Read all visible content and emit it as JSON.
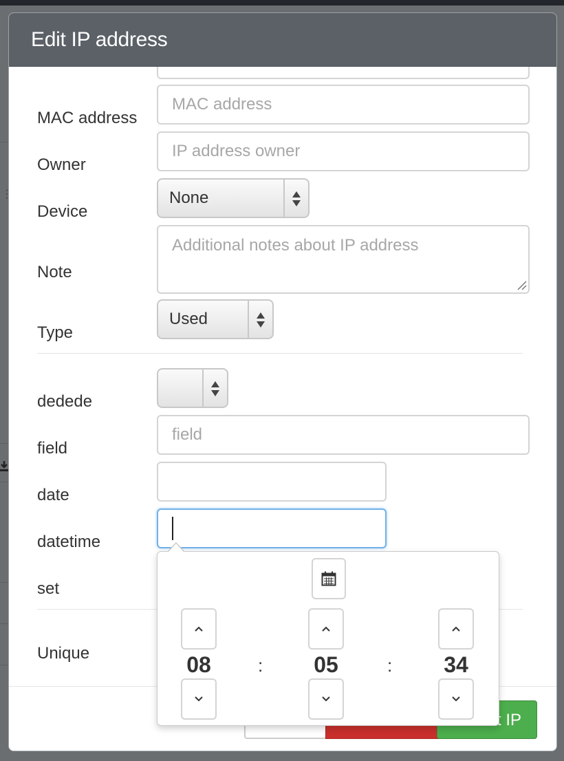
{
  "modal": {
    "title": "Edit IP address"
  },
  "form": {
    "mac_label": "MAC address",
    "mac_placeholder": "MAC address",
    "owner_label": "Owner",
    "owner_placeholder": "IP address owner",
    "device_label": "Device",
    "device_value": "None",
    "note_label": "Note",
    "note_placeholder": "Additional notes about IP address",
    "type_label": "Type",
    "type_value": "Used",
    "dedede_label": "dedede",
    "dedede_value": "",
    "field_label": "field",
    "field_placeholder": "field",
    "date_label": "date",
    "date_value": "",
    "datetime_label": "datetime",
    "datetime_value": "",
    "set_label": "set",
    "unique_label": "Unique"
  },
  "footer": {
    "edit_label": "t IP"
  },
  "timepicker": {
    "hours": "08",
    "minutes": "05",
    "seconds": "34",
    "separator": ":"
  }
}
